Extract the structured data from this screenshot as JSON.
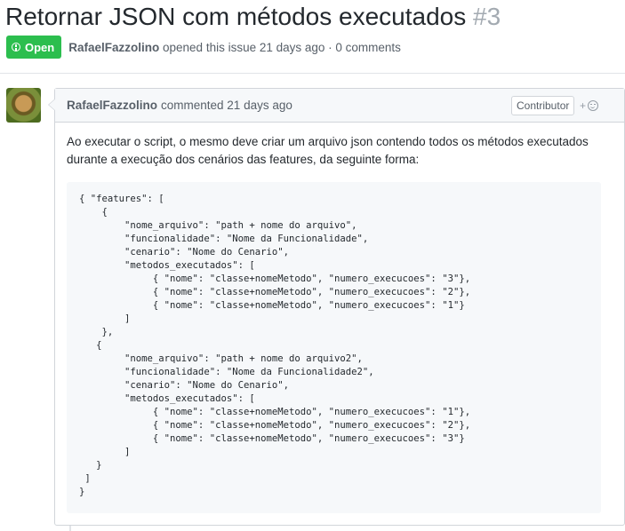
{
  "issue": {
    "title": "Retornar JSON com métodos executados",
    "number": "#3",
    "state": "Open",
    "state_color": "#2cbe4e",
    "author": "RafaelFazzolino",
    "opened_text": "opened this issue 21 days ago · 0 comments"
  },
  "comment": {
    "author": "RafaelFazzolino",
    "action": "commented 21 days ago",
    "badge": "Contributor",
    "reaction_plus": "+",
    "reaction_icon": "smiley-icon",
    "body": "Ao executar o script, o mesmo deve criar um arquivo json contendo todos os métodos executados durante a execução dos cenários das features, da seguinte forma:",
    "code": "{ \"features\": [\n    {\n        \"nome_arquivo\": \"path + nome do arquivo\",\n        \"funcionalidade\": \"Nome da Funcionalidade\",\n        \"cenario\": \"Nome do Cenario\",\n        \"metodos_executados\": [\n             { \"nome\": \"classe+nomeMetodo\", \"numero_execucoes\": \"3\"},\n             { \"nome\": \"classe+nomeMetodo\", \"numero_execucoes\": \"2\"},\n             { \"nome\": \"classe+nomeMetodo\", \"numero_execucoes\": \"1\"}\n        ]\n    },\n   {\n        \"nome_arquivo\": \"path + nome do arquivo2\",\n        \"funcionalidade\": \"Nome da Funcionalidade2\",\n        \"cenario\": \"Nome do Cenario\",\n        \"metodos_executados\": [\n             { \"nome\": \"classe+nomeMetodo\", \"numero_execucoes\": \"1\"},\n             { \"nome\": \"classe+nomeMetodo\", \"numero_execucoes\": \"2\"},\n             { \"nome\": \"classe+nomeMetodo\", \"numero_execucoes\": \"3\"}\n        ]\n   }\n ]\n}"
  }
}
